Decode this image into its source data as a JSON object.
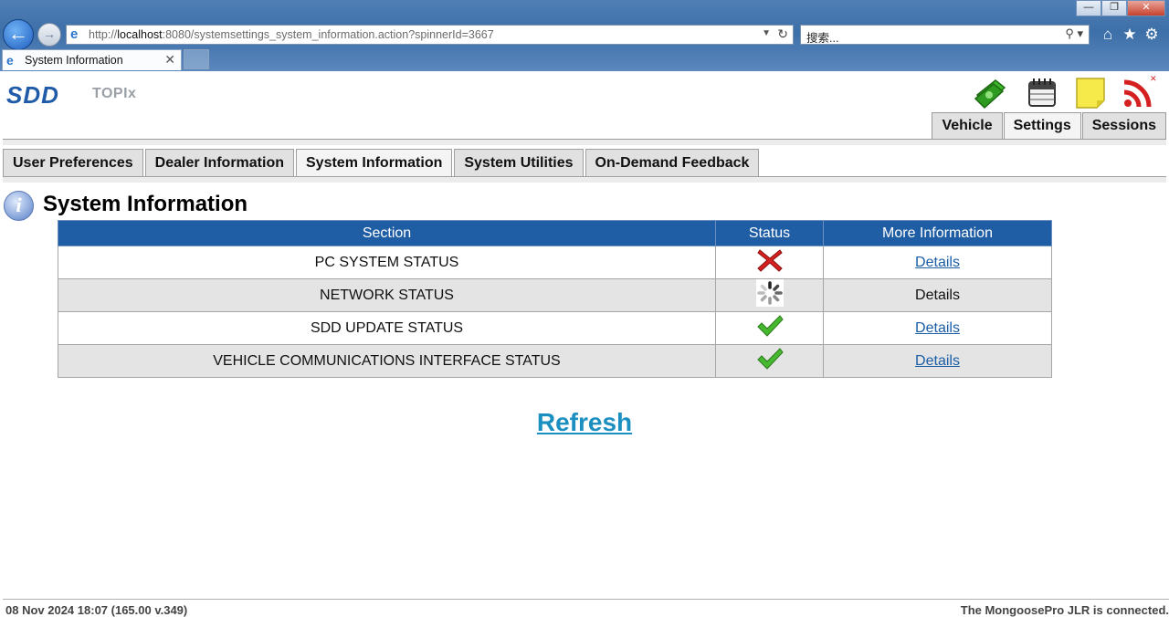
{
  "browser": {
    "url_prefix": "http://",
    "url_host": "localhost",
    "url_rest": ":8080/systemsettings_system_information.action?spinnerId=3667",
    "search_placeholder": "搜索...",
    "tab_title": "System Information",
    "window_controls": [
      "—",
      "❐",
      "✕"
    ]
  },
  "app": {
    "logo": "SDD",
    "product": "TOPIx",
    "header_icons": [
      "dealer-money-icon",
      "calendar-icon",
      "note-icon",
      "rss-connection-icon"
    ],
    "main_tabs": [
      {
        "label": "Vehicle",
        "active": false
      },
      {
        "label": "Settings",
        "active": true
      },
      {
        "label": "Sessions",
        "active": false
      }
    ],
    "sub_tabs": [
      {
        "label": "User Preferences",
        "active": false
      },
      {
        "label": "Dealer Information",
        "active": false
      },
      {
        "label": "System Information",
        "active": true
      },
      {
        "label": "System Utilities",
        "active": false
      },
      {
        "label": "On-Demand Feedback",
        "active": false
      }
    ]
  },
  "page": {
    "title": "System Information",
    "columns": [
      "Section",
      "Status",
      "More Information"
    ],
    "rows": [
      {
        "section": "PC SYSTEM STATUS",
        "status": "error",
        "more": "Details",
        "link": true
      },
      {
        "section": "NETWORK STATUS",
        "status": "loading",
        "more": "Details",
        "link": false
      },
      {
        "section": "SDD UPDATE STATUS",
        "status": "ok",
        "more": "Details",
        "link": true
      },
      {
        "section": "VEHICLE COMMUNICATIONS INTERFACE STATUS",
        "status": "ok",
        "more": "Details",
        "link": true
      }
    ],
    "refresh_label": "Refresh"
  },
  "footer": {
    "left": "08 Nov 2024 18:07 (165.00 v.349)",
    "right": "The MongoosePro JLR is connected."
  },
  "colors": {
    "table_header": "#1f5da4",
    "link": "#1a5ea8",
    "refresh": "#1a8fc0",
    "error": "#d62020",
    "ok": "#3fae2a"
  }
}
